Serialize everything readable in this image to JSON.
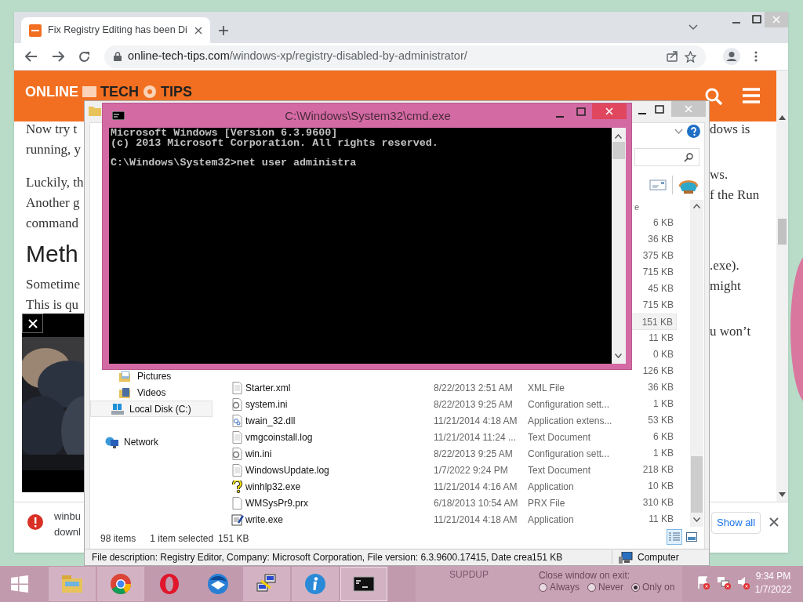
{
  "browser": {
    "tab": {
      "title": "Fix Registry Editing has been Di",
      "selected": true
    },
    "url": {
      "domain": "online-tech-tips.com",
      "path": "/windows-xp/registry-disabled-by-administrator/"
    },
    "site_logo": [
      "ONLINE",
      "TECH",
      "TIPS"
    ],
    "article_left": [
      {
        "kind": "text",
        "text": "Now try t"
      },
      {
        "kind": "text",
        "text": "running, y"
      },
      {
        "kind": "gap"
      },
      {
        "kind": "text",
        "text": "Luckily, th"
      },
      {
        "kind": "text",
        "text": "Another g"
      },
      {
        "kind": "text",
        "text": "command"
      },
      {
        "kind": "heading",
        "text": "Meth"
      },
      {
        "kind": "text",
        "text": "Sometime"
      },
      {
        "kind": "text",
        "text": "This is qu"
      }
    ],
    "article_right": [
      {
        "kind": "text",
        "text": "dows is"
      },
      {
        "kind": "gap"
      },
      {
        "kind": "gap"
      },
      {
        "kind": "text",
        "text": "ws."
      },
      {
        "kind": "text",
        "text": "f the Run"
      },
      {
        "kind": "gap"
      },
      {
        "kind": "gap"
      },
      {
        "kind": "gap"
      },
      {
        "kind": "gap"
      },
      {
        "kind": "text",
        "text": ".exe)."
      },
      {
        "kind": "text",
        "text": "might"
      },
      {
        "kind": "gap"
      },
      {
        "kind": "gap"
      },
      {
        "kind": "text",
        "text": "u won’t"
      }
    ],
    "download_bar": {
      "lines": [
        "winbu",
        "downl"
      ],
      "show_all": "Show all"
    }
  },
  "explorer": {
    "column_fragment": "e",
    "nav": [
      {
        "label": "Pictures",
        "selected": false
      },
      {
        "label": "Videos",
        "selected": false
      },
      {
        "label": "Local Disk (C:)",
        "selected": true
      },
      {
        "label": "Network",
        "selected": false
      }
    ],
    "rows": [
      {
        "size": "6 KB",
        "selected": false
      },
      {
        "size": "36 KB",
        "selected": false
      },
      {
        "size": "375 KB",
        "selected": false
      },
      {
        "size": "715 KB",
        "selected": false
      },
      {
        "size": "45 KB",
        "selected": false
      },
      {
        "size": "715 KB",
        "selected": false
      },
      {
        "size": "151 KB",
        "selected": true
      },
      {
        "size": "11 KB",
        "selected": false
      },
      {
        "size": "0 KB",
        "selected": false
      },
      {
        "size": "126 KB",
        "selected": false
      },
      {
        "name": "Starter.xml",
        "date": "8/22/2013 2:51 AM",
        "type": "XML File",
        "size": "36 KB",
        "selected": false,
        "kind": "doc"
      },
      {
        "name": "system.ini",
        "date": "8/22/2013 9:25 AM",
        "type": "Configuration sett...",
        "size": "1 KB",
        "selected": false,
        "kind": "config"
      },
      {
        "name": "twain_32.dll",
        "date": "11/21/2014 4:18 AM",
        "type": "Application extens...",
        "size": "53 KB",
        "selected": false,
        "kind": "dll"
      },
      {
        "name": "vmgcoinstall.log",
        "date": "11/21/2014 11:24 ...",
        "type": "Text Document",
        "size": "6 KB",
        "selected": false,
        "kind": "doc"
      },
      {
        "name": "win.ini",
        "date": "8/22/2013 9:25 AM",
        "type": "Configuration sett...",
        "size": "1 KB",
        "selected": false,
        "kind": "config"
      },
      {
        "name": "WindowsUpdate.log",
        "date": "1/7/2022 9:24 PM",
        "type": "Text Document",
        "size": "218 KB",
        "selected": false,
        "kind": "doc"
      },
      {
        "name": "winhlp32.exe",
        "date": "11/21/2014 4:16 AM",
        "type": "Application",
        "size": "10 KB",
        "selected": false,
        "kind": "help"
      },
      {
        "name": "WMSysPr9.prx",
        "date": "6/18/2013 10:54 AM",
        "type": "PRX File",
        "size": "310 KB",
        "selected": false,
        "kind": "blank"
      },
      {
        "name": "write.exe",
        "date": "11/21/2014 4:18 AM",
        "type": "Application",
        "size": "11 KB",
        "selected": false,
        "kind": "write"
      }
    ],
    "status": {
      "count": "98 items",
      "selection": "1 item selected",
      "size": "151 KB"
    },
    "views": [
      {
        "kind": "details",
        "selected": true
      },
      {
        "kind": "tiles",
        "selected": false
      }
    ],
    "details_bar": {
      "description": "File description: Registry Editor, Company: Microsoft Corporation, File version: 6.3.9600.17415, Date crea",
      "size": "151 KB",
      "location": "Computer"
    }
  },
  "cmd": {
    "title": "C:\\Windows\\System32\\cmd.exe",
    "lines": [
      {
        "kind": "line",
        "text": "Microsoft Windows [Version 6.3.9600]"
      },
      {
        "kind": "line",
        "text": "(c) 2013 Microsoft Corporation. All rights reserved."
      },
      {
        "kind": "blank"
      },
      {
        "kind": "line",
        "text": "C:\\Windows\\System32>net user administra"
      }
    ]
  },
  "taskbar": {
    "apps": [
      {
        "kind": "explorer",
        "running": true,
        "selected": false
      },
      {
        "kind": "chrome",
        "running": true,
        "selected": false
      },
      {
        "kind": "opera",
        "running": false,
        "selected": false
      },
      {
        "kind": "thunderbird",
        "running": false,
        "selected": false
      },
      {
        "kind": "putty",
        "running": true,
        "selected": false
      },
      {
        "kind": "info",
        "running": true,
        "selected": false
      },
      {
        "kind": "cmd",
        "running": true,
        "selected": true
      }
    ],
    "background_window": {
      "label": "SUPDUP",
      "group": "Close window on exit:",
      "options": [
        {
          "label": "Always",
          "selected": false
        },
        {
          "label": "Never",
          "selected": false
        },
        {
          "label": "Only on",
          "selected": true
        }
      ]
    },
    "time": "9:34 PM",
    "date": "1/7/2022"
  }
}
